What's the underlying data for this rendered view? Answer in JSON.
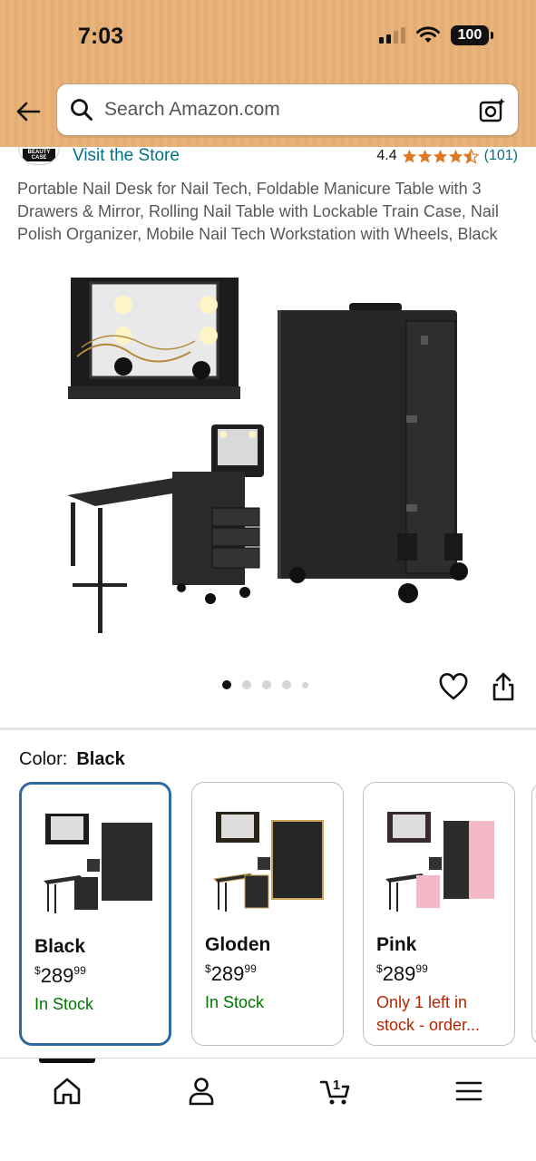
{
  "status_bar": {
    "time": "7:03",
    "battery": "100"
  },
  "search": {
    "placeholder": "Search Amazon.com"
  },
  "store": {
    "logo_text": "BEAUTY CASE",
    "visit_label": "Visit the Store",
    "rating_value": "4.4",
    "rating_stars": 4.4,
    "rating_count": "(101)"
  },
  "product": {
    "title": "Portable Nail Desk for Nail Tech, Foldable Manicure Table with 3 Drawers & Mirror, Rolling Nail Table with Lockable Train Case, Nail Polish Organizer, Mobile Nail Tech Workstation with Wheels, Black",
    "image_count": 5,
    "active_image": 1
  },
  "color": {
    "label": "Color:",
    "selected": "Black",
    "options": [
      {
        "name": "Black",
        "price_whole": "289",
        "price_fraction": "99",
        "currency": "$",
        "stock": "In Stock",
        "accent": "#1f1f1f"
      },
      {
        "name": "Gloden",
        "price_whole": "289",
        "price_fraction": "99",
        "currency": "$",
        "stock": "In Stock",
        "accent": "#c9a45a"
      },
      {
        "name": "Pink",
        "price_whole": "289",
        "price_fraction": "99",
        "currency": "$",
        "stock": "Only 1 left in stock - order...",
        "accent": "#f2b8c6"
      }
    ]
  },
  "nav": {
    "items": [
      "home-icon",
      "account-icon",
      "cart-icon",
      "menu-icon"
    ],
    "cart_count": "1"
  },
  "colors": {
    "link": "#007185",
    "in_stock": "#007600",
    "low_stock": "#b12704",
    "selected_border": "#2f6a9e",
    "star": "#de7921"
  }
}
